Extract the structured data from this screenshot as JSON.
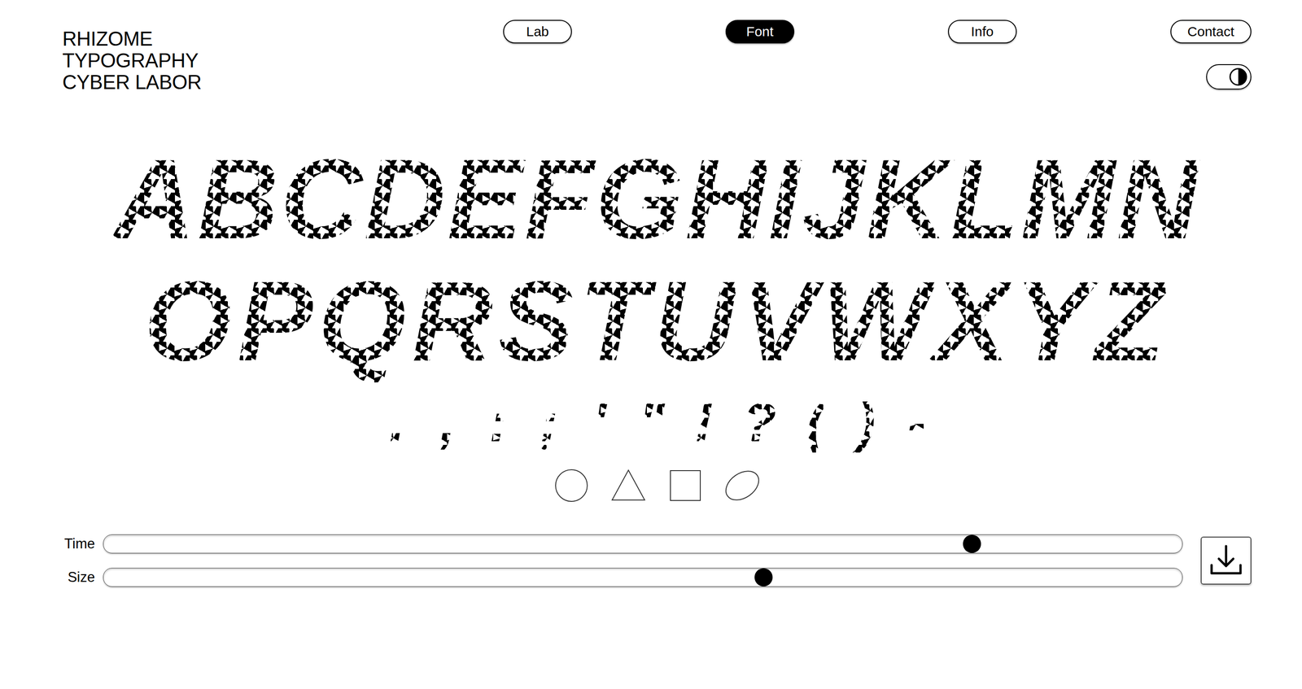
{
  "logo": {
    "lines": [
      "RHIZOME",
      "TYPOGRAPHY",
      "CYBER LABOR"
    ]
  },
  "nav": [
    {
      "label": "Lab",
      "selected": false
    },
    {
      "label": "Font",
      "selected": true
    },
    {
      "label": "Info",
      "selected": false
    },
    {
      "label": "Contact",
      "selected": false
    }
  ],
  "specimen": {
    "rows": [
      "ABCDEFGHIJKLMN",
      "OPQRSTUVWXYZ"
    ],
    "punctuation": [
      ".",
      ",",
      ":",
      ";",
      "'",
      "\"",
      "!",
      "?",
      "(",
      ")",
      "-"
    ]
  },
  "shapes": [
    {
      "kind": "circle"
    },
    {
      "kind": "triangle"
    },
    {
      "kind": "square"
    },
    {
      "kind": "ellipse"
    }
  ],
  "sliders": [
    {
      "label": "Time",
      "level": 0.805
    },
    {
      "label": "Size",
      "level": 0.612
    }
  ]
}
